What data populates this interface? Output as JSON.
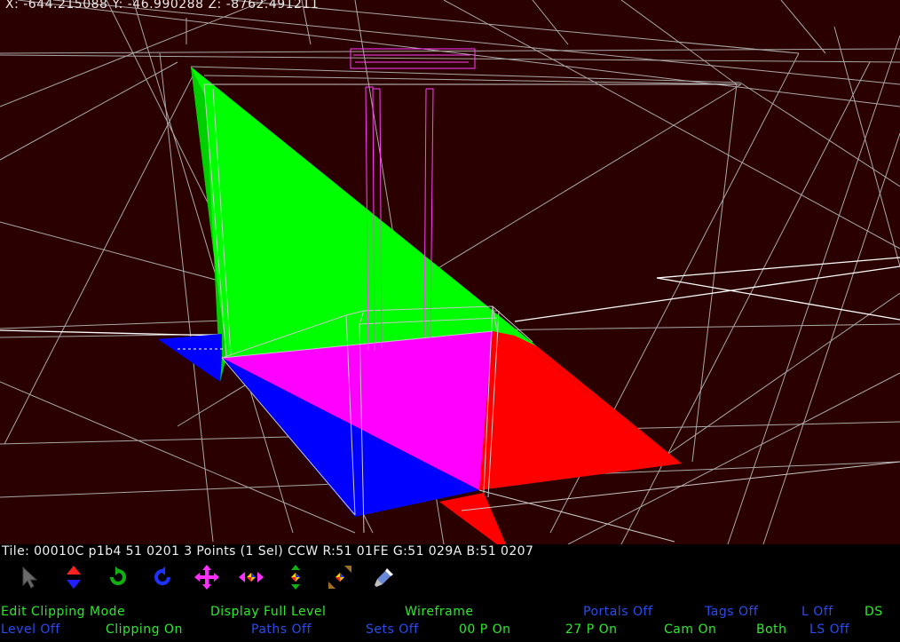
{
  "viewport": {
    "coordinates": "X: -644.215088 Y: -46.990288 Z: -8762.491211"
  },
  "info_bar": {
    "tile_info": "Tile: 00010C p1b4 51 0201 3 Points (1 Sel) CCW R:51 01FE G:51 029A B:51 0207"
  },
  "toolbar": {
    "tools": [
      "select-arrow",
      "move-vertical",
      "rotate-ccw",
      "rotate-cw",
      "move-all",
      "move-horizontal",
      "move-depth",
      "scale-diagonal",
      "paint-brush"
    ]
  },
  "status": {
    "row1": {
      "edit_mode": "Edit Clipping Mode",
      "display_mode": "Display Full Level",
      "render_mode": "Wireframe",
      "portals": "Portals Off",
      "tags": "Tags Off",
      "lights": "L Off",
      "ds": "DS"
    },
    "row2": {
      "level": "Level Off",
      "clipping": "Clipping On",
      "paths": "Paths Off",
      "sets": "Sets Off",
      "p00": "00 P On",
      "p27": "27 P On",
      "cam": "Cam On",
      "both": "Both",
      "ls": "LS Off"
    }
  },
  "colors": {
    "background": "#2b0000",
    "green_face": "#00ff00",
    "magenta_face": "#ff00ff",
    "red_face": "#ff0000",
    "blue_face": "#0000ff",
    "status_on": "#2ee82e",
    "status_off": "#2a4cf0"
  }
}
